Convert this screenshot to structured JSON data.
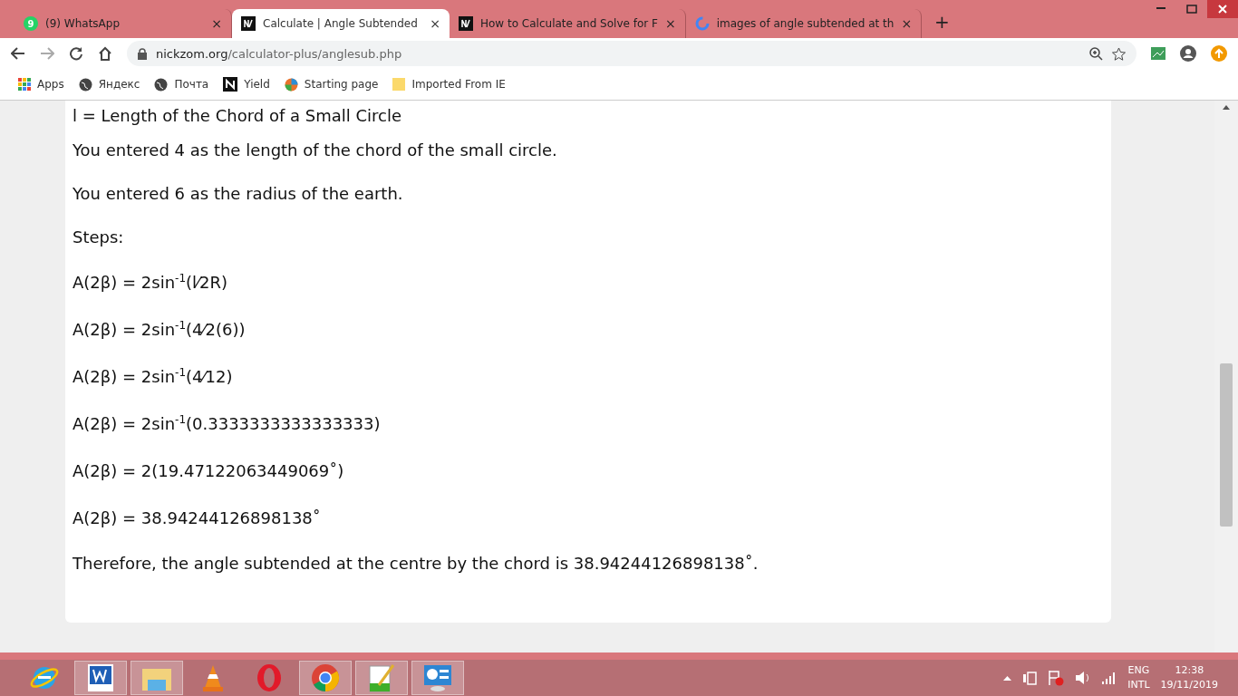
{
  "tabs": [
    {
      "title": "(9) WhatsApp",
      "selected": false,
      "badge": "9",
      "close": "×"
    },
    {
      "title": "Calculate | Angle Subtended",
      "selected": true,
      "close": "×"
    },
    {
      "title": "How to Calculate and Solve for F",
      "selected": false,
      "close": "×"
    },
    {
      "title": "images of angle subtended at th",
      "selected": false,
      "close": "×"
    }
  ],
  "new_tab": "+",
  "address": {
    "host": "nickzom.org",
    "path": "/calculator-plus/anglesub.php"
  },
  "bookmarks": [
    "Apps",
    "Яндекс",
    "Почта",
    "Yield",
    "Starting page",
    "Imported From IE"
  ],
  "content": {
    "heading": "l = Length of the Chord of a Small Circle",
    "paragraphs": [
      "You entered 4 as the length of the chord of the small circle.",
      "You entered 6 as the radius of the earth.",
      "Steps:"
    ],
    "steps": [
      "A(2β) = 2sin$^{-1}$(l⁄2R)",
      "A(2β) = 2sin$^{-1}$(4⁄2(6))",
      "A(2β) = 2sin$^{-1}$(4⁄12)",
      "A(2β) = 2sin$^{-1}$(0.3333333333333333)",
      "A(2β) = 2(19.47122063449069˚)",
      "A(2β) = 38.94244126898138˚"
    ],
    "conclusion": "Therefore, the angle subtended at the centre by the chord is 38.94244126898138˚."
  },
  "taskbar": {
    "apps": [
      {
        "open": false
      },
      {
        "open": true
      },
      {
        "open": true
      },
      {
        "open": false
      },
      {
        "open": false
      },
      {
        "open": true
      },
      {
        "open": true
      },
      {
        "open": true
      }
    ],
    "language": "ENG",
    "layout": "INTL",
    "time": "12:38",
    "date": "19/11/2019"
  }
}
